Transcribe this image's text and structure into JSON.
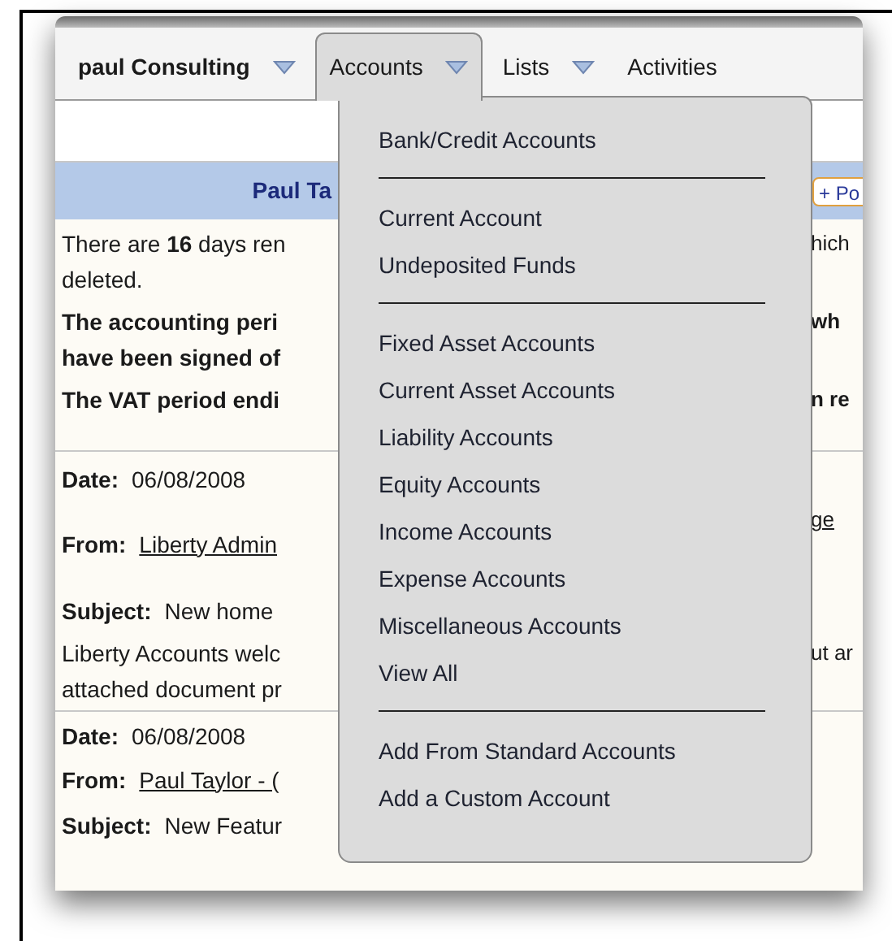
{
  "menubar": [
    {
      "label": "paul Consulting",
      "dropdown": true,
      "selected": false,
      "bold": true
    },
    {
      "label": "Accounts",
      "dropdown": true,
      "selected": true,
      "bold": false
    },
    {
      "label": "Lists",
      "dropdown": true,
      "selected": false,
      "bold": false
    },
    {
      "label": "Activities",
      "dropdown": false,
      "selected": false,
      "bold": false
    }
  ],
  "header": {
    "title": "Paul Ta",
    "button": "+ Po"
  },
  "notice": [
    {
      "left": "There are **16** days ren",
      "right": "hich",
      "bold": false,
      "gap": false
    },
    {
      "left": "deleted.",
      "bold": false,
      "gap": false
    },
    {
      "left": "The accounting peri",
      "right": "wh",
      "bold": true,
      "gap": true
    },
    {
      "left": "have been signed of",
      "bold": true,
      "gap": false
    },
    {
      "left": "The VAT period endi",
      "right": "n re",
      "bold": true,
      "gap": true
    }
  ],
  "messages": [
    {
      "date_label": "Date:",
      "date": "06/08/2008",
      "from_label": "From:",
      "from": "Liberty Admin",
      "from_right": "ge",
      "subject_label": "Subject:",
      "subject": "New home",
      "body": [
        {
          "left": "Liberty Accounts welc",
          "right": "ut ar"
        },
        {
          "left": "attached document pr"
        }
      ]
    },
    {
      "date_label": "Date:",
      "date": "06/08/2008",
      "from_label": "From:",
      "from": "Paul Taylor - (",
      "subject_label": "Subject:",
      "subject": "New Featur"
    }
  ],
  "menu": [
    [
      "Bank/Credit Accounts"
    ],
    [
      "Current Account",
      "Undeposited Funds"
    ],
    [
      "Fixed Asset Accounts",
      "Current Asset Accounts",
      "Liability Accounts",
      "Equity Accounts",
      "Income Accounts",
      "Expense Accounts",
      "Miscellaneous Accounts",
      "View All"
    ],
    [
      "Add From Standard Accounts",
      "Add a Custom Account"
    ]
  ]
}
